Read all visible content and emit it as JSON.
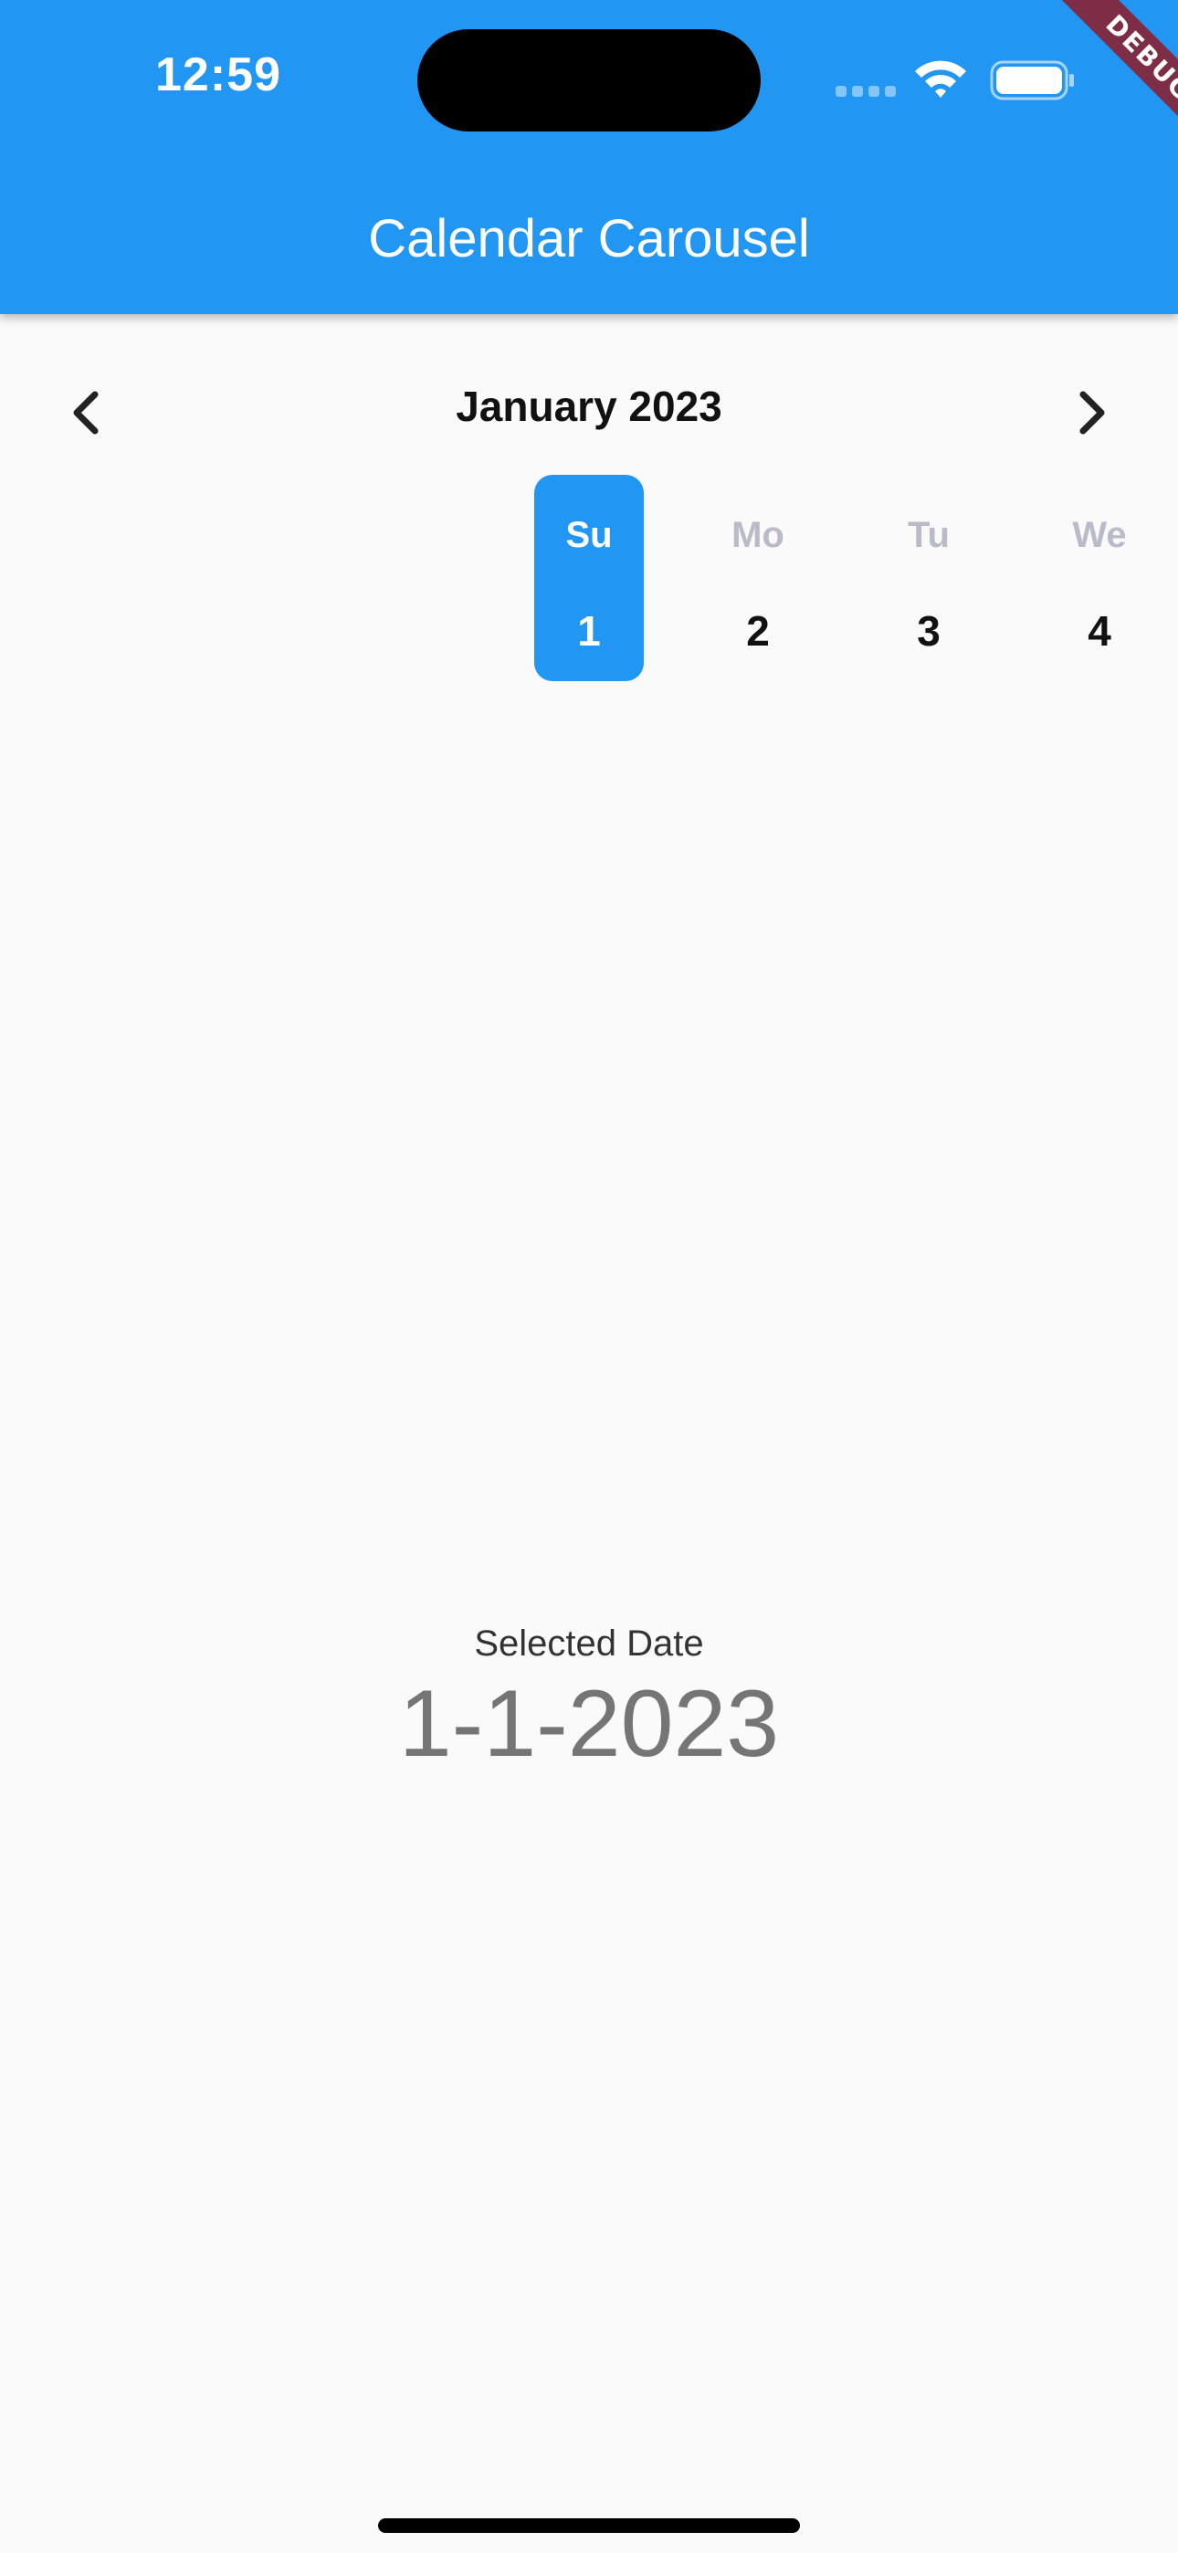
{
  "status_bar": {
    "time": "12:59"
  },
  "debug_banner": "DEBUG",
  "app_bar": {
    "title": "Calendar Carousel"
  },
  "calendar": {
    "month_label": "January 2023",
    "prev_icon": "chevron-left-icon",
    "next_icon": "chevron-right-icon",
    "days": [
      {
        "name": "Su",
        "number": "1",
        "selected": true
      },
      {
        "name": "Mo",
        "number": "2",
        "selected": false
      },
      {
        "name": "Tu",
        "number": "3",
        "selected": false
      },
      {
        "name": "We",
        "number": "4",
        "selected": false
      }
    ]
  },
  "selection": {
    "label": "Selected Date",
    "value": "1-1-2023"
  },
  "colors": {
    "primary": "#2196f3",
    "background": "#fafafa",
    "debug_banner": "#7d2e46",
    "weekday_inactive": "#b9bcc8"
  }
}
